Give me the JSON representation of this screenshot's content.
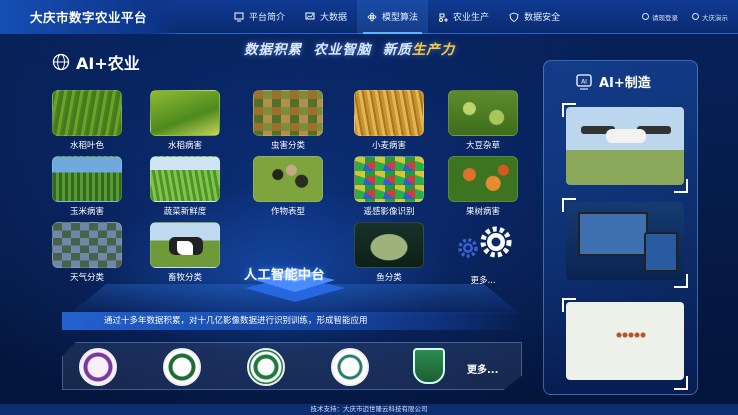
{
  "brand": {
    "title": "大庆市数字农业平台"
  },
  "nav": {
    "items": [
      {
        "label": "平台简介",
        "icon": "monitor-icon"
      },
      {
        "label": "大数据",
        "icon": "screen-icon"
      },
      {
        "label": "模型算法",
        "icon": "atom-icon",
        "active": true
      },
      {
        "label": "农业生产",
        "icon": "tractor-icon"
      },
      {
        "label": "数据安全",
        "icon": "shield-icon"
      }
    ]
  },
  "top_right": {
    "login": "请现登录",
    "user": "大庆演示"
  },
  "slogan": {
    "part1": "数据积累",
    "part2": "农业智脑",
    "part3": "新质",
    "part4": "生产力"
  },
  "left": {
    "title": "AI+农业",
    "cards": [
      {
        "label": "水稻叶色"
      },
      {
        "label": "水稻病害"
      },
      {
        "label": "虫害分类"
      },
      {
        "label": "小麦病害"
      },
      {
        "label": "大豆杂草"
      },
      {
        "label": "玉米病害"
      },
      {
        "label": "蔬菜新鲜度"
      },
      {
        "label": "作物表型"
      },
      {
        "label": "遥感影像识别"
      },
      {
        "label": "果树病害"
      },
      {
        "label": "天气分类"
      },
      {
        "label": "畜牧分类"
      },
      {
        "label": "鱼分类"
      },
      {
        "label": "更多..."
      }
    ],
    "center_label": "人工智能中台",
    "description": "通过十多年数据积累，对十几亿影像数据进行识别训练，形成智能应用",
    "partners_more": "更多..."
  },
  "right": {
    "title": "AI+制造"
  },
  "footer": {
    "text": "技术支持：大庆市迈世隆云科技有限公司"
  },
  "colors": {
    "accent": "#56b7ff",
    "highlight": "#ffcc33",
    "background": "#061a46"
  }
}
